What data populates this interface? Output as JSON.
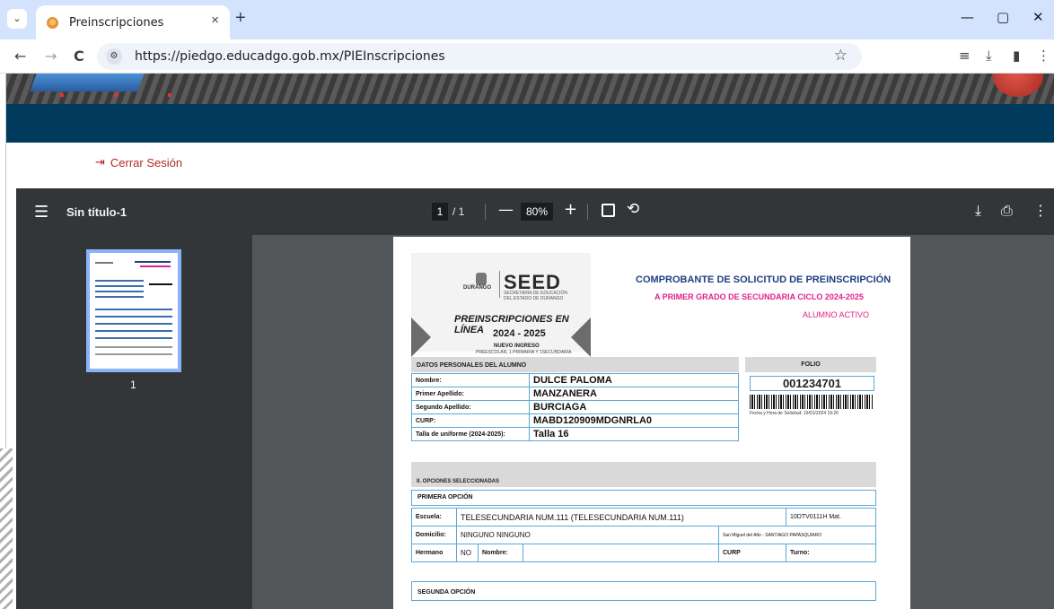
{
  "browser": {
    "tab_title": "Preinscripciones",
    "tab_close": "×",
    "new_tab": "+",
    "tab_menu": "⌄",
    "url": "https://piedgo.educadgo.gob.mx/PIEInscripciones",
    "window_controls": {
      "minimize": "—",
      "maximize": "▢",
      "close": "✕"
    },
    "nav": {
      "back": "←",
      "forward": "→",
      "reload": "C"
    },
    "toolbar_icons": {
      "site_info": "site-settings-icon",
      "bookmark": "star-icon",
      "reading_list": "reading-list-icon",
      "download": "download-icon",
      "sidebar": "side-panel-icon",
      "menu": "menu-icon"
    }
  },
  "page": {
    "logout_label": "Cerrar Sesión",
    "colors": {
      "navy": "#003a5c",
      "logout": "#b22a2a",
      "accent_pink": "#e0218a",
      "title_blue": "#1f3f82",
      "table_border": "#5aa8d6"
    }
  },
  "pdf_viewer": {
    "doc_title": "Sin título-1",
    "current_page": "1",
    "total_pages": "/ 1",
    "zoom": "80%",
    "zoom_out": "—",
    "zoom_in": "+",
    "thumbnail_label": "1"
  },
  "document": {
    "logo": {
      "state": "DURANGO",
      "seed": "SEED",
      "seed_sub": "SECRETARÍA DE EDUCACIÓN DEL ESTADO DE DURANGO",
      "heading": "PREINSCRIPCIONES EN LÍNEA",
      "years": "2024 - 2025",
      "nuevo": "NUEVO INGRESO",
      "niveles": "PREESCOLAR, 1 PRIMARIA Y 1SECUNDARIA"
    },
    "title": "COMPROBANTE DE SOLICITUD DE PREINSCRIPCIÓN",
    "subtitle": "A PRIMER GRADO DE SECUNDARIA CICLO  2024-2025",
    "status": "ALUMNO ACTIVO",
    "section1": {
      "heading": "DATOS PERSONALES DEL ALUMNO",
      "rows": [
        {
          "label": "Nombre:",
          "value": "DULCE PALOMA"
        },
        {
          "label": "Primer Apellido:",
          "value": "MANZANERA"
        },
        {
          "label": "Segundo Apellido:",
          "value": "BURCIAGA"
        },
        {
          "label": "CURP:",
          "value": "MABD120909MDGNRLA0"
        },
        {
          "label": "Talla de uniforme (2024-2025):",
          "value": "Talla 16"
        }
      ]
    },
    "folio": {
      "heading": "FOLIO",
      "number": "001234701",
      "fecha": "Fecha y Hora de Solicitud:  19/01/2024 19:26"
    },
    "section2": {
      "heading": "II. OPCIONES SELECCIONADAS",
      "primera": {
        "heading": "PRIMERA OPCIÓN",
        "escuela_label": "Escuela:",
        "escuela": "TELESECUNDARIA NUM.111 (TELESECUNDARIA NUM.111)",
        "clave": "10DTV0111H  Mat.",
        "domicilio_label": "Domicilio:",
        "domicilio": "NINGUNO NINGUNO",
        "localidad": "San Miguel del Alto - SANTIAGO PAPASQUIARO",
        "hermano_label": "Hermano",
        "hermano": "NO",
        "nombre_label": "Nombre:",
        "curp_label": "CURP",
        "turno_label": "Turno:"
      },
      "segunda": {
        "heading": "SEGUNDA OPCIÓN"
      }
    }
  }
}
